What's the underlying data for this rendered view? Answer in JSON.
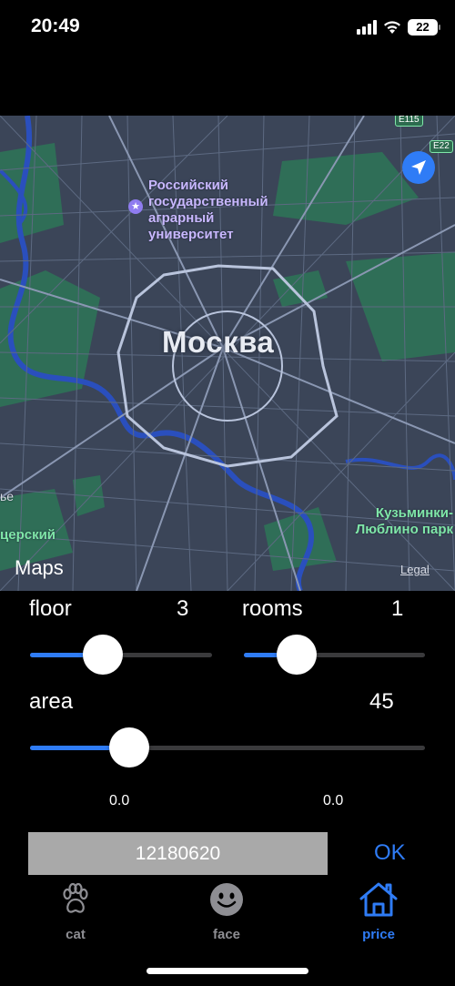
{
  "status": {
    "time": "20:49",
    "battery": "22"
  },
  "map": {
    "university_label": "Российский государственный аграрный университет",
    "city_label": "Москва",
    "park_label": "Кузьминки-Люблино парк",
    "partial_label_left": "ье",
    "partial_label_park_left": "церский",
    "road_badges": [
      "E115",
      "E22"
    ],
    "brand": "Maps",
    "legal": "Legal",
    "icons": [
      "location-arrow-icon",
      "star-icon",
      "apple-icon"
    ]
  },
  "controls": {
    "floor": {
      "label": "floor",
      "value": "3",
      "fraction": 0.4
    },
    "rooms": {
      "label": "rooms",
      "value": "1",
      "fraction": 0.29
    },
    "area": {
      "label": "area",
      "value": "45",
      "fraction": 0.25
    },
    "extra_left": "0.0",
    "extra_right": "0.0"
  },
  "price": {
    "value": "12180620",
    "ok_label": "OK"
  },
  "tabs": [
    {
      "label": "cat",
      "icon": "paw-icon",
      "active": false
    },
    {
      "label": "face",
      "icon": "smiley-face-icon",
      "active": false
    },
    {
      "label": "price",
      "icon": "house-icon",
      "active": true
    }
  ],
  "colors": {
    "accent": "#2f7cf6",
    "map_bg": "#3b4558",
    "park": "#2f6e57",
    "water": "#2a4fbd"
  }
}
